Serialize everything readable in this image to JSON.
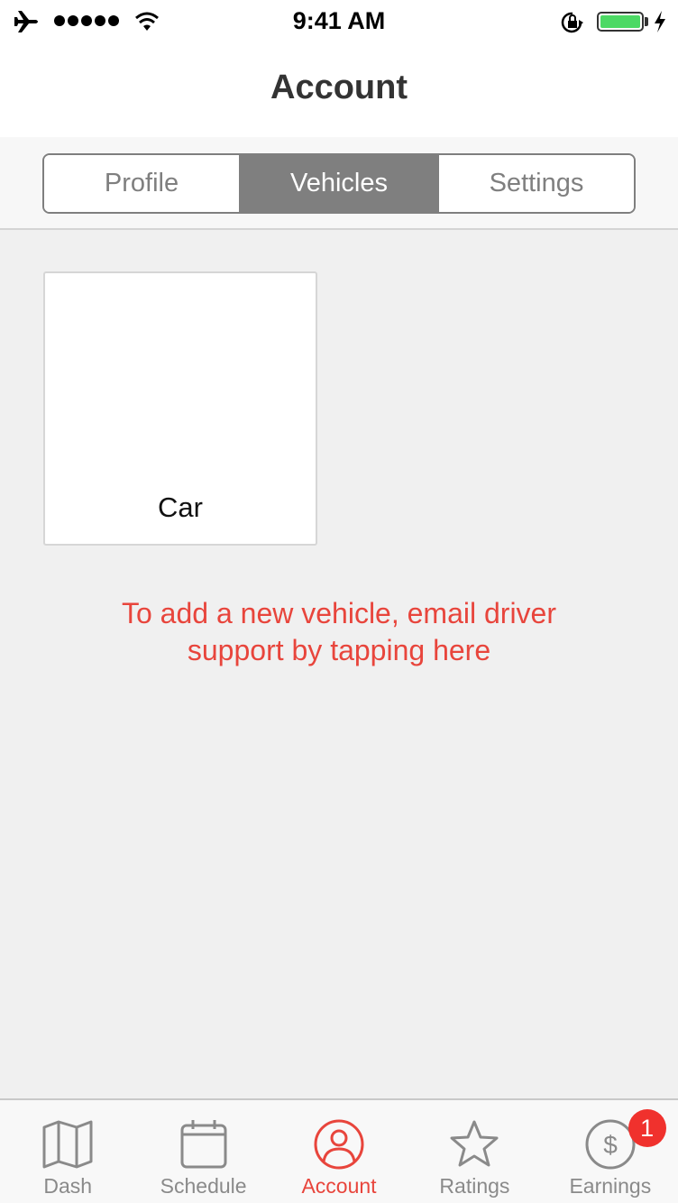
{
  "status_bar": {
    "time": "9:41 AM",
    "icons": [
      "airplane-mode-icon",
      "signal-dots-icon",
      "wifi-icon",
      "orientation-lock-icon",
      "battery-icon",
      "charging-bolt-icon"
    ],
    "battery_level": 1.0,
    "battery_color": "#4cd964"
  },
  "nav": {
    "title": "Account"
  },
  "segments": {
    "items": [
      {
        "label": "Profile",
        "active": false
      },
      {
        "label": "Vehicles",
        "active": true
      },
      {
        "label": "Settings",
        "active": false
      }
    ]
  },
  "vehicles": [
    {
      "name": "Car"
    }
  ],
  "add_vehicle": {
    "line1": "To add a new vehicle, email driver",
    "line2": "support by tapping here",
    "color": "#e8453c"
  },
  "tab_bar": {
    "items": [
      {
        "label": "Dash",
        "icon": "map-icon",
        "active": false
      },
      {
        "label": "Schedule",
        "icon": "calendar-icon",
        "active": false
      },
      {
        "label": "Account",
        "icon": "user-circle-icon",
        "active": true
      },
      {
        "label": "Ratings",
        "icon": "star-icon",
        "active": false
      },
      {
        "label": "Earnings",
        "icon": "dollar-circle-icon",
        "active": false,
        "badge": "1"
      }
    ],
    "active_color": "#e8453c",
    "inactive_color": "#8a8a8a"
  }
}
